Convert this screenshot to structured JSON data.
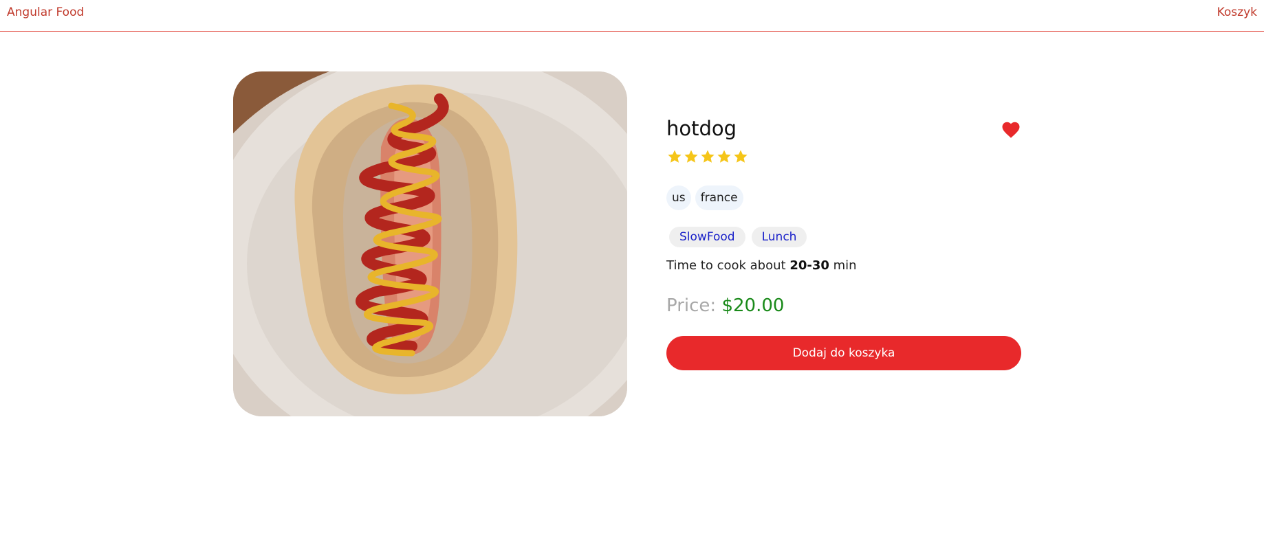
{
  "header": {
    "brand": "Angular Food",
    "cart_link": "Koszyk"
  },
  "food": {
    "image_icon": "hotdog-photo",
    "name": "hotdog",
    "favorite": true,
    "favorite_icon": "heart-icon",
    "rating": 5,
    "rating_max": 5,
    "origins": [
      "us",
      "france"
    ],
    "tags": [
      "SlowFood",
      "Lunch"
    ],
    "cook_time_prefix": "Time to cook about",
    "cook_time_value": "20-30",
    "cook_time_suffix": "min",
    "price_label": "Price:",
    "price_value": "$20.00",
    "add_to_cart_label": "Dodaj do koszyka"
  },
  "colors": {
    "accent": "#e8292b",
    "header_link": "#c0392b",
    "star": "#f5c518",
    "price": "#1a8a1a",
    "tag_text": "#1a21c9",
    "favorite": "#e8292b"
  }
}
